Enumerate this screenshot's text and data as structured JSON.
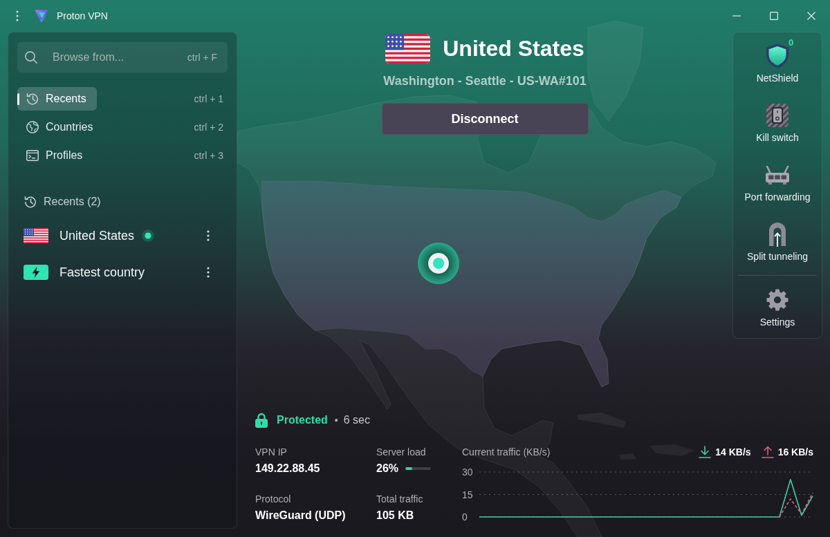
{
  "window": {
    "title": "Proton VPN"
  },
  "search": {
    "placeholder": "Browse from...",
    "shortcut": "ctrl + F"
  },
  "nav": [
    {
      "kind": "recents",
      "label": "Recents",
      "shortcut": "ctrl + 1",
      "selected": true
    },
    {
      "kind": "countries",
      "label": "Countries",
      "shortcut": "ctrl + 2",
      "selected": false
    },
    {
      "kind": "profiles",
      "label": "Profiles",
      "shortcut": "ctrl + 3",
      "selected": false
    }
  ],
  "recents": {
    "title": "Recents (2)",
    "items": [
      {
        "kind": "country",
        "label": "United States",
        "connected": true
      },
      {
        "kind": "fastest",
        "label": "Fastest country",
        "connected": false
      }
    ]
  },
  "connection": {
    "country": "United States",
    "server": "Washington - Seattle - US-WA#101",
    "action": "Disconnect"
  },
  "features": [
    {
      "kind": "netshield",
      "label": "NetShield",
      "badge": "0"
    },
    {
      "kind": "killswitch",
      "label": "Kill switch"
    },
    {
      "kind": "portforwarding",
      "label": "Port forwarding"
    },
    {
      "kind": "splittunneling",
      "label": "Split tunneling"
    }
  ],
  "settings": {
    "label": "Settings"
  },
  "status": {
    "protected": true,
    "label": "Protected",
    "separator": "•",
    "duration": "6 sec"
  },
  "stats": [
    {
      "kind": "text",
      "label": "VPN IP",
      "value": "149.22.88.45"
    },
    {
      "kind": "meter",
      "label": "Server load",
      "value": "26%",
      "level": 0.26
    },
    {
      "kind": "text",
      "label": "Protocol",
      "value": "WireGuard (UDP)"
    },
    {
      "kind": "text",
      "label": "Total traffic",
      "value": "105 KB"
    }
  ],
  "traffic": {
    "download": "14 KB/s",
    "upload": "16 KB/s",
    "chart_data": {
      "type": "line",
      "title": "Current traffic (KB/s)",
      "categories": [
        null,
        null,
        null,
        null,
        null,
        null,
        null,
        null,
        null,
        null,
        null,
        null,
        null,
        null,
        null,
        null,
        null,
        null,
        null,
        null,
        null,
        null,
        null,
        null,
        null,
        null,
        null,
        null,
        null,
        null,
        null
      ],
      "ylim": [
        0,
        30
      ],
      "yticks": [
        0,
        15,
        30
      ],
      "series": [
        {
          "color": "#3ecfa8",
          "line_style": "solid",
          "values": [
            0,
            0,
            0,
            0,
            0,
            0,
            0,
            0,
            0,
            0,
            0,
            0,
            0,
            0,
            0,
            0,
            0,
            0,
            0,
            0,
            0,
            0,
            0,
            0,
            0,
            0,
            0,
            0,
            25,
            1,
            14
          ]
        },
        {
          "color": "#e0607e",
          "line_style": "dashed",
          "values": [
            null,
            null,
            null,
            null,
            null,
            null,
            null,
            null,
            null,
            null,
            null,
            null,
            null,
            null,
            null,
            null,
            null,
            null,
            null,
            null,
            null,
            null,
            null,
            null,
            null,
            null,
            null,
            0,
            12,
            2,
            16
          ]
        }
      ]
    }
  }
}
